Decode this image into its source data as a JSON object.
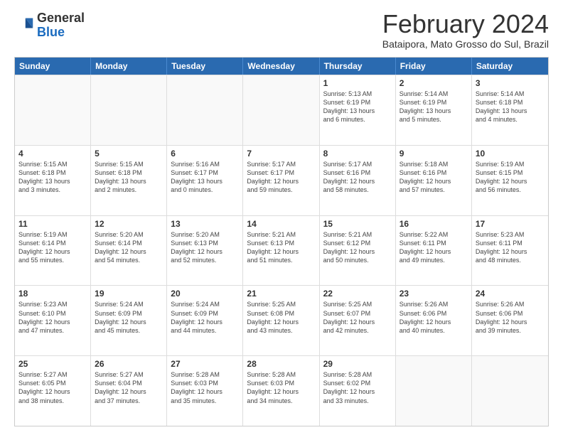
{
  "logo": {
    "general": "General",
    "blue": "Blue"
  },
  "title": "February 2024",
  "location": "Bataipora, Mato Grosso do Sul, Brazil",
  "header_days": [
    "Sunday",
    "Monday",
    "Tuesday",
    "Wednesday",
    "Thursday",
    "Friday",
    "Saturday"
  ],
  "rows": [
    [
      {
        "day": "",
        "info": ""
      },
      {
        "day": "",
        "info": ""
      },
      {
        "day": "",
        "info": ""
      },
      {
        "day": "",
        "info": ""
      },
      {
        "day": "1",
        "info": "Sunrise: 5:13 AM\nSunset: 6:19 PM\nDaylight: 13 hours\nand 6 minutes."
      },
      {
        "day": "2",
        "info": "Sunrise: 5:14 AM\nSunset: 6:19 PM\nDaylight: 13 hours\nand 5 minutes."
      },
      {
        "day": "3",
        "info": "Sunrise: 5:14 AM\nSunset: 6:18 PM\nDaylight: 13 hours\nand 4 minutes."
      }
    ],
    [
      {
        "day": "4",
        "info": "Sunrise: 5:15 AM\nSunset: 6:18 PM\nDaylight: 13 hours\nand 3 minutes."
      },
      {
        "day": "5",
        "info": "Sunrise: 5:15 AM\nSunset: 6:18 PM\nDaylight: 13 hours\nand 2 minutes."
      },
      {
        "day": "6",
        "info": "Sunrise: 5:16 AM\nSunset: 6:17 PM\nDaylight: 13 hours\nand 0 minutes."
      },
      {
        "day": "7",
        "info": "Sunrise: 5:17 AM\nSunset: 6:17 PM\nDaylight: 12 hours\nand 59 minutes."
      },
      {
        "day": "8",
        "info": "Sunrise: 5:17 AM\nSunset: 6:16 PM\nDaylight: 12 hours\nand 58 minutes."
      },
      {
        "day": "9",
        "info": "Sunrise: 5:18 AM\nSunset: 6:16 PM\nDaylight: 12 hours\nand 57 minutes."
      },
      {
        "day": "10",
        "info": "Sunrise: 5:19 AM\nSunset: 6:15 PM\nDaylight: 12 hours\nand 56 minutes."
      }
    ],
    [
      {
        "day": "11",
        "info": "Sunrise: 5:19 AM\nSunset: 6:14 PM\nDaylight: 12 hours\nand 55 minutes."
      },
      {
        "day": "12",
        "info": "Sunrise: 5:20 AM\nSunset: 6:14 PM\nDaylight: 12 hours\nand 54 minutes."
      },
      {
        "day": "13",
        "info": "Sunrise: 5:20 AM\nSunset: 6:13 PM\nDaylight: 12 hours\nand 52 minutes."
      },
      {
        "day": "14",
        "info": "Sunrise: 5:21 AM\nSunset: 6:13 PM\nDaylight: 12 hours\nand 51 minutes."
      },
      {
        "day": "15",
        "info": "Sunrise: 5:21 AM\nSunset: 6:12 PM\nDaylight: 12 hours\nand 50 minutes."
      },
      {
        "day": "16",
        "info": "Sunrise: 5:22 AM\nSunset: 6:11 PM\nDaylight: 12 hours\nand 49 minutes."
      },
      {
        "day": "17",
        "info": "Sunrise: 5:23 AM\nSunset: 6:11 PM\nDaylight: 12 hours\nand 48 minutes."
      }
    ],
    [
      {
        "day": "18",
        "info": "Sunrise: 5:23 AM\nSunset: 6:10 PM\nDaylight: 12 hours\nand 47 minutes."
      },
      {
        "day": "19",
        "info": "Sunrise: 5:24 AM\nSunset: 6:09 PM\nDaylight: 12 hours\nand 45 minutes."
      },
      {
        "day": "20",
        "info": "Sunrise: 5:24 AM\nSunset: 6:09 PM\nDaylight: 12 hours\nand 44 minutes."
      },
      {
        "day": "21",
        "info": "Sunrise: 5:25 AM\nSunset: 6:08 PM\nDaylight: 12 hours\nand 43 minutes."
      },
      {
        "day": "22",
        "info": "Sunrise: 5:25 AM\nSunset: 6:07 PM\nDaylight: 12 hours\nand 42 minutes."
      },
      {
        "day": "23",
        "info": "Sunrise: 5:26 AM\nSunset: 6:06 PM\nDaylight: 12 hours\nand 40 minutes."
      },
      {
        "day": "24",
        "info": "Sunrise: 5:26 AM\nSunset: 6:06 PM\nDaylight: 12 hours\nand 39 minutes."
      }
    ],
    [
      {
        "day": "25",
        "info": "Sunrise: 5:27 AM\nSunset: 6:05 PM\nDaylight: 12 hours\nand 38 minutes."
      },
      {
        "day": "26",
        "info": "Sunrise: 5:27 AM\nSunset: 6:04 PM\nDaylight: 12 hours\nand 37 minutes."
      },
      {
        "day": "27",
        "info": "Sunrise: 5:28 AM\nSunset: 6:03 PM\nDaylight: 12 hours\nand 35 minutes."
      },
      {
        "day": "28",
        "info": "Sunrise: 5:28 AM\nSunset: 6:03 PM\nDaylight: 12 hours\nand 34 minutes."
      },
      {
        "day": "29",
        "info": "Sunrise: 5:28 AM\nSunset: 6:02 PM\nDaylight: 12 hours\nand 33 minutes."
      },
      {
        "day": "",
        "info": ""
      },
      {
        "day": "",
        "info": ""
      }
    ]
  ]
}
